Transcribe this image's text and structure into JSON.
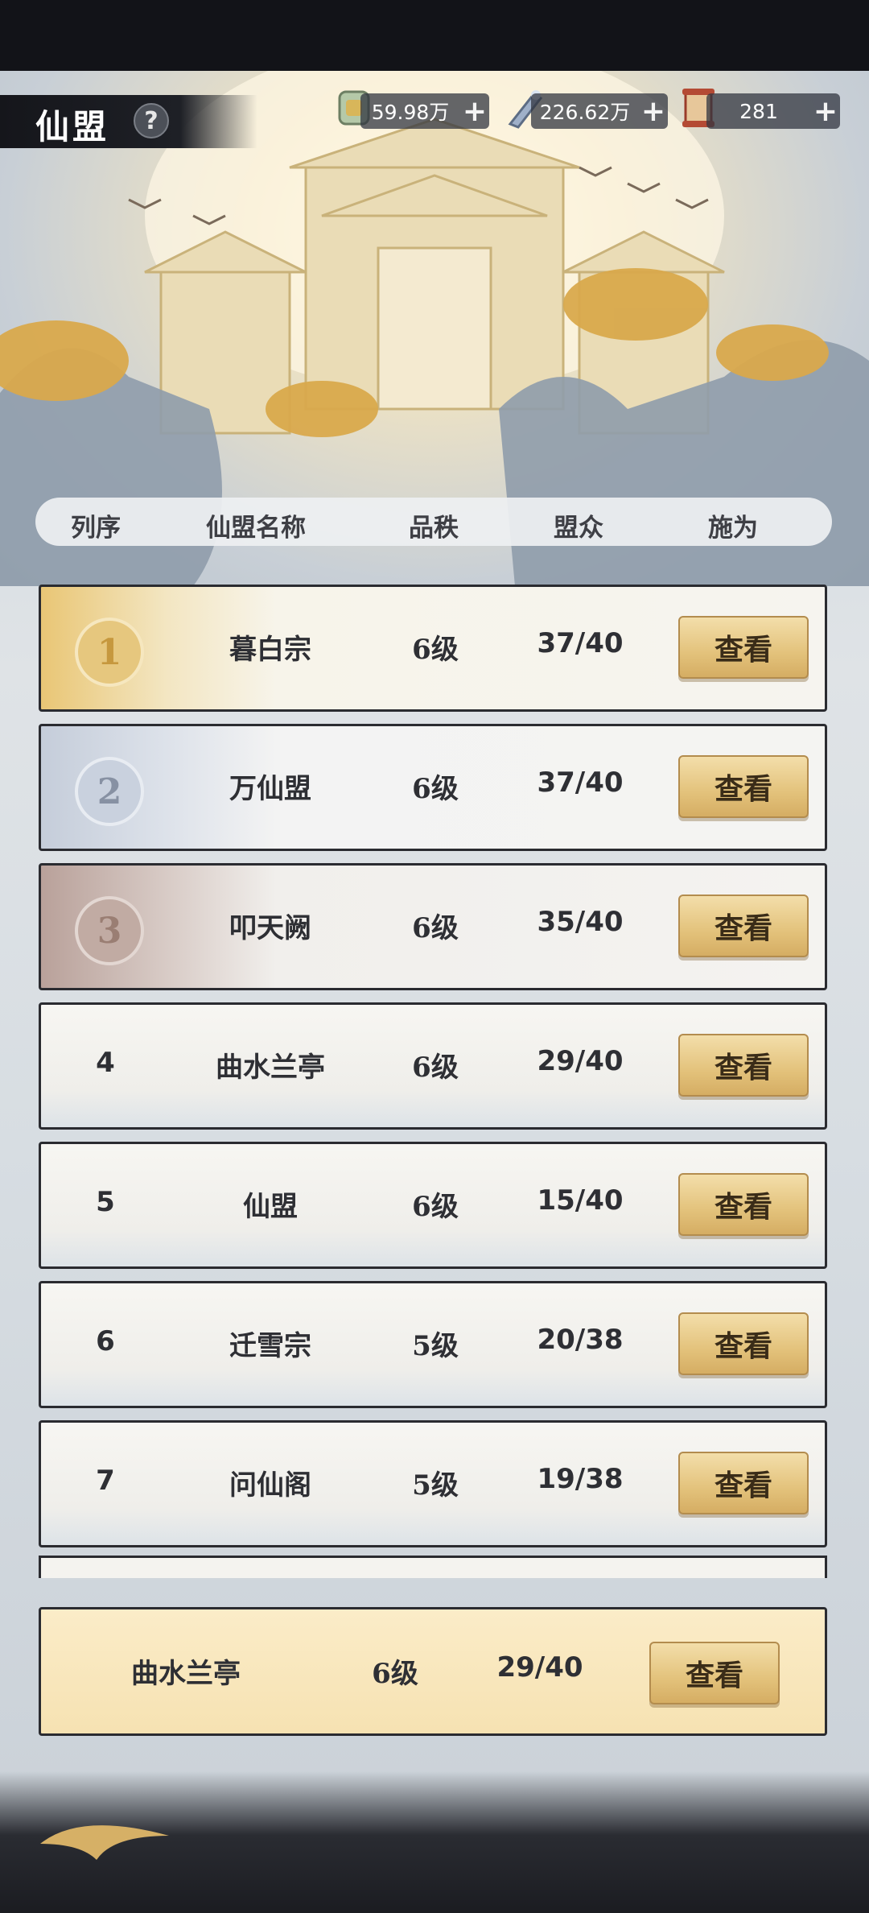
{
  "title": "仙盟",
  "help_label": "?",
  "resources": [
    {
      "icon": "jade-token-icon",
      "value": "59.98万",
      "plus": "+"
    },
    {
      "icon": "spirit-gourd-icon",
      "value": "226.62万",
      "plus": "+"
    },
    {
      "icon": "scroll-icon",
      "value": "281",
      "plus": "+"
    }
  ],
  "headers": {
    "rank": "列序",
    "name": "仙盟名称",
    "level": "品秩",
    "members": "盟众",
    "action": "施为"
  },
  "rows": [
    {
      "rank": "1",
      "name": "暮白宗",
      "level": "6级",
      "members": "37/40",
      "action": "查看"
    },
    {
      "rank": "2",
      "name": "万仙盟",
      "level": "6级",
      "members": "37/40",
      "action": "查看"
    },
    {
      "rank": "3",
      "name": "叩天阙",
      "level": "6级",
      "members": "35/40",
      "action": "查看"
    },
    {
      "rank": "4",
      "name": "曲水兰亭",
      "level": "6级",
      "members": "29/40",
      "action": "查看"
    },
    {
      "rank": "5",
      "name": "仙盟",
      "level": "6级",
      "members": "15/40",
      "action": "查看"
    },
    {
      "rank": "6",
      "name": "迁雪宗",
      "level": "5级",
      "members": "20/38",
      "action": "查看"
    },
    {
      "rank": "7",
      "name": "问仙阁",
      "level": "5级",
      "members": "19/38",
      "action": "查看"
    }
  ],
  "my_alliance": {
    "name": "曲水兰亭",
    "level": "6级",
    "members": "29/40",
    "action": "查看"
  }
}
